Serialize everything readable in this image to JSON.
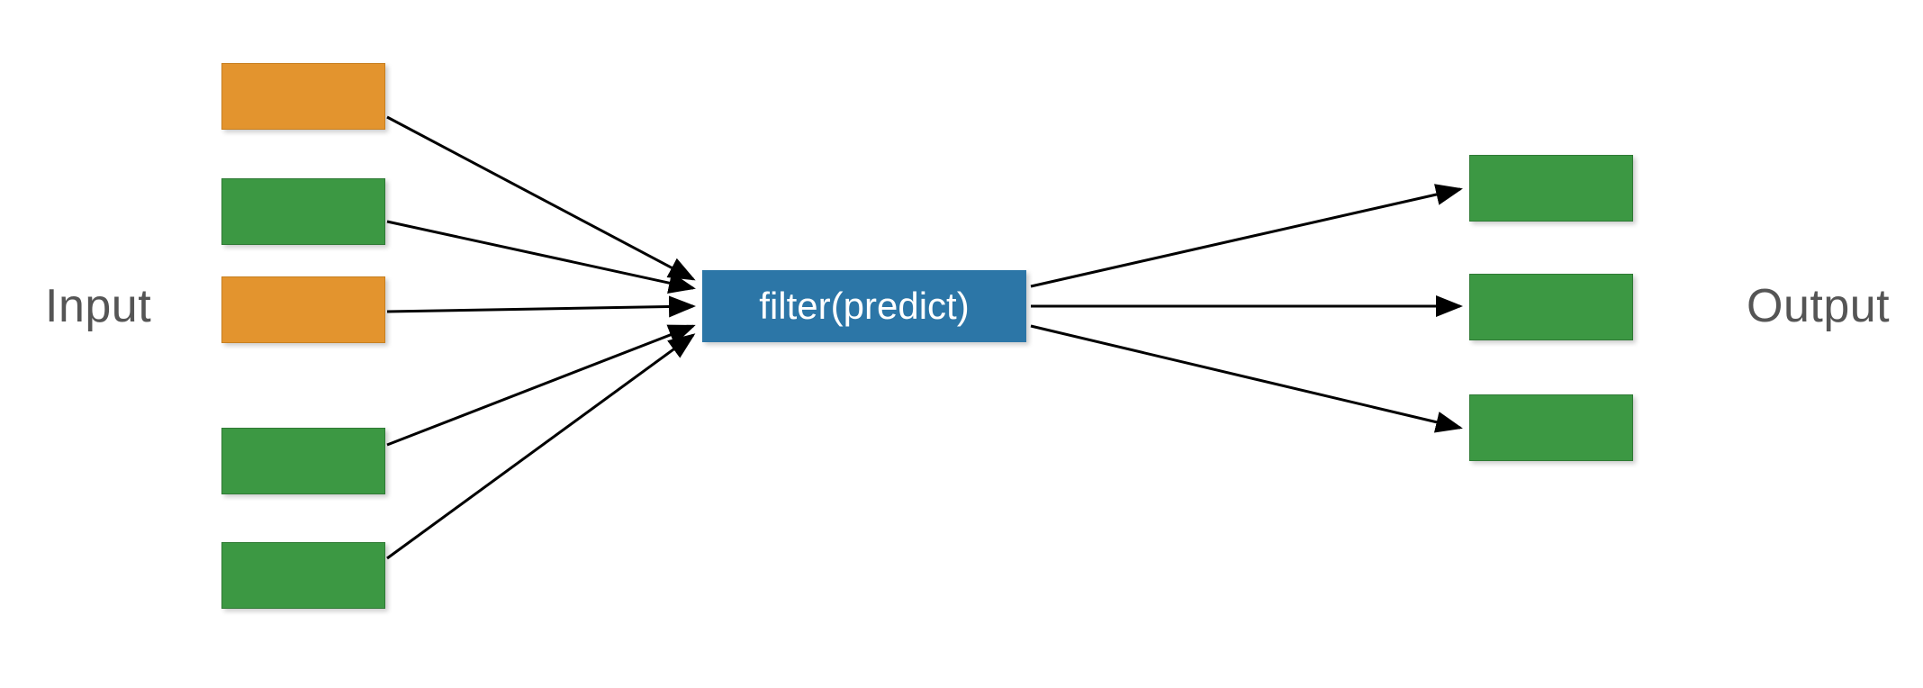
{
  "labels": {
    "input": "Input",
    "output": "Output"
  },
  "filter": {
    "text": "filter(predict)"
  },
  "colors": {
    "orange": "#e3942e",
    "green": "#3c9843",
    "blue": "#2c76a7",
    "text": "#555555"
  },
  "diagram": {
    "inputs": [
      {
        "type": "orange"
      },
      {
        "type": "green"
      },
      {
        "type": "orange"
      },
      {
        "type": "green"
      },
      {
        "type": "green"
      }
    ],
    "outputs": [
      {
        "type": "green"
      },
      {
        "type": "green"
      },
      {
        "type": "green"
      }
    ]
  }
}
